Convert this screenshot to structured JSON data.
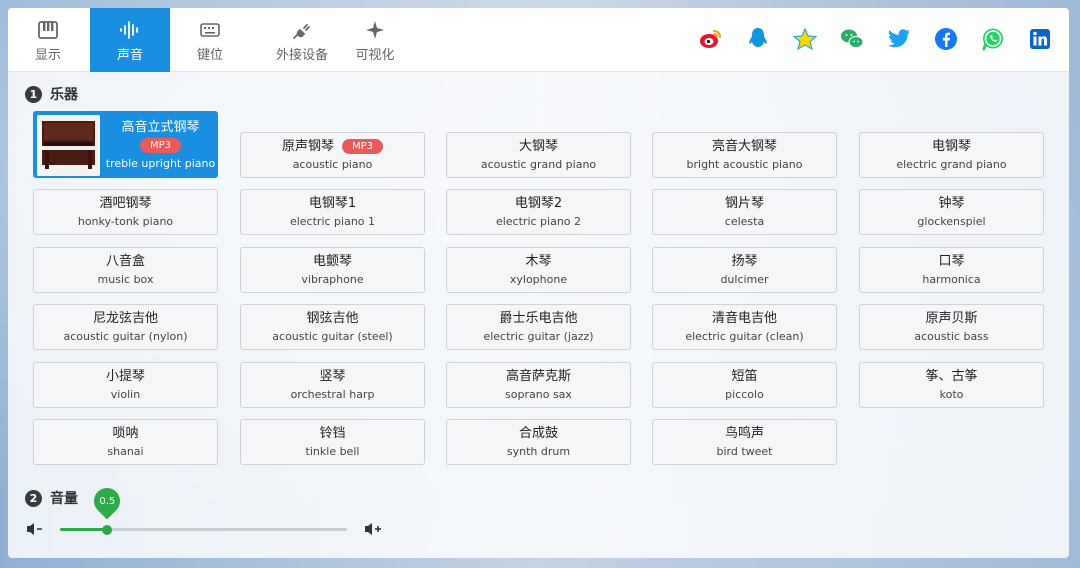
{
  "tabs": [
    {
      "label": "显示",
      "icon": "piano-keys-icon"
    },
    {
      "label": "声音",
      "icon": "sound-wave-icon",
      "active": true
    },
    {
      "label": "键位",
      "icon": "keyboard-icon"
    },
    {
      "label": "外接设备",
      "icon": "plug-icon"
    },
    {
      "label": "可视化",
      "icon": "sparkle-icon"
    }
  ],
  "social": [
    "weibo-icon",
    "qq-icon",
    "star-icon",
    "wechat-icon",
    "twitter-icon",
    "facebook-icon",
    "whatsapp-icon",
    "linkedin-icon"
  ],
  "sections": {
    "instruments": {
      "num": "1",
      "title": "乐器"
    },
    "volume": {
      "num": "2",
      "title": "音量"
    }
  },
  "instruments": [
    {
      "cn": "高音立式钢琴",
      "en": "treble upright piano",
      "mp3": "MP3",
      "selected": true
    },
    {
      "cn": "原声钢琴",
      "en": "acoustic piano",
      "mp3": "MP3"
    },
    {
      "cn": "大钢琴",
      "en": "acoustic grand piano"
    },
    {
      "cn": "亮音大钢琴",
      "en": "bright acoustic piano"
    },
    {
      "cn": "电钢琴",
      "en": "electric grand piano"
    },
    {
      "cn": "酒吧钢琴",
      "en": "honky-tonk piano"
    },
    {
      "cn": "电钢琴1",
      "en": "electric piano 1"
    },
    {
      "cn": "电钢琴2",
      "en": "electric piano 2"
    },
    {
      "cn": "钢片琴",
      "en": "celesta"
    },
    {
      "cn": "钟琴",
      "en": "glockenspiel"
    },
    {
      "cn": "八音盒",
      "en": "music box"
    },
    {
      "cn": "电颤琴",
      "en": "vibraphone"
    },
    {
      "cn": "木琴",
      "en": "xylophone"
    },
    {
      "cn": "扬琴",
      "en": "dulcimer"
    },
    {
      "cn": "口琴",
      "en": "harmonica"
    },
    {
      "cn": "尼龙弦吉他",
      "en": "acoustic guitar (nylon)"
    },
    {
      "cn": "钢弦吉他",
      "en": "acoustic guitar (steel)"
    },
    {
      "cn": "爵士乐电吉他",
      "en": "electric guitar (jazz)"
    },
    {
      "cn": "清音电吉他",
      "en": "electric guitar (clean)"
    },
    {
      "cn": "原声贝斯",
      "en": "acoustic bass"
    },
    {
      "cn": "小提琴",
      "en": "violin"
    },
    {
      "cn": "竖琴",
      "en": "orchestral harp"
    },
    {
      "cn": "高音萨克斯",
      "en": "soprano sax"
    },
    {
      "cn": "短笛",
      "en": "piccolo"
    },
    {
      "cn": "筝、古筝",
      "en": "koto"
    },
    {
      "cn": "唢呐",
      "en": "shanai"
    },
    {
      "cn": "铃铛",
      "en": "tinkle bell"
    },
    {
      "cn": "合成鼓",
      "en": "synth drum"
    },
    {
      "cn": "鸟鸣声",
      "en": "bird tweet"
    }
  ],
  "volume": {
    "value": 0.5,
    "label": "0.5",
    "min": 0,
    "max": 1
  },
  "colors": {
    "accent": "#1a8fe0",
    "slider": "#2eaa4a",
    "mp3_badge": "#ea5a5a"
  }
}
